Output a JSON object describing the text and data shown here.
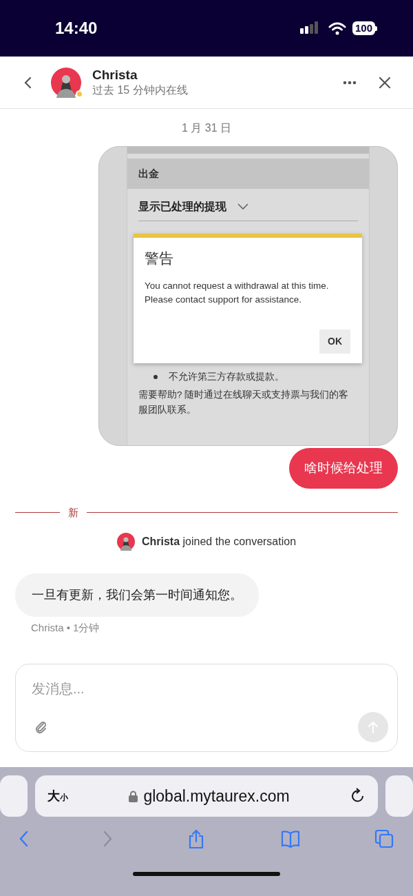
{
  "status_bar": {
    "time": "14:40",
    "battery": "100"
  },
  "header": {
    "name": "Christa",
    "presence": "过去 15 分钟内在线"
  },
  "messages": [
    {
      "kind": "date",
      "text": "1 月 31 日"
    },
    {
      "kind": "screenshot",
      "section_title": "出金",
      "dropdown": "显示已处理的提现",
      "dialog": {
        "title": "警告",
        "message": "You cannot request a withdrawal at this time. Please contact support for assistance.",
        "button": "OK"
      },
      "bullets": [
        "不允许第三方存款或提款。"
      ],
      "help": "需要帮助? 随时通过在线聊天或支持票与我们的客服团队联系。"
    },
    {
      "kind": "outgoing",
      "text": "啥时候给处理"
    },
    {
      "kind": "divider",
      "text": "新"
    },
    {
      "kind": "event",
      "text": "**Christa** joined the conversation"
    },
    {
      "kind": "incoming",
      "text": "一旦有更新，我们会第一时间通知您。",
      "meta": "Christa • 1分钟"
    }
  ],
  "composer": {
    "placeholder": "发消息..."
  },
  "browser": {
    "text_size_large": "大",
    "text_size_small": "小",
    "url": "global.mytaurex.com"
  }
}
